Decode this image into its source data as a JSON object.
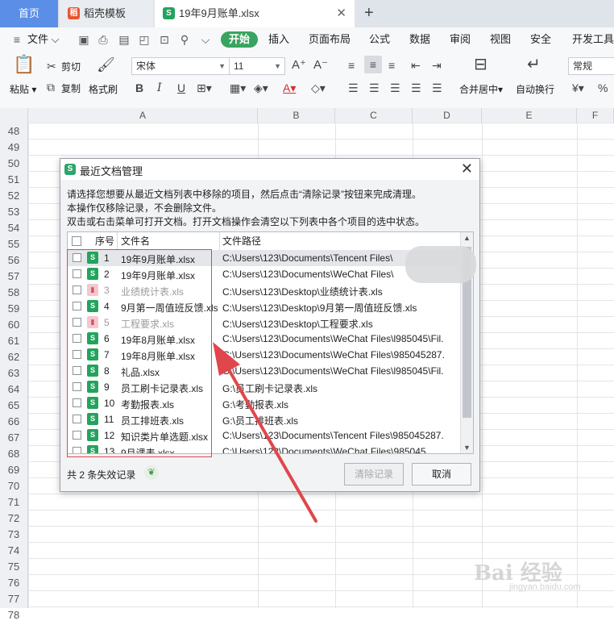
{
  "tabs": [
    {
      "label": "首页"
    },
    {
      "label": "稻壳模板"
    },
    {
      "label": "19年9月账单.xlsx"
    }
  ],
  "menu": {
    "file": "文件",
    "items": [
      "开始",
      "插入",
      "页面布局",
      "公式",
      "数据",
      "审阅",
      "视图",
      "安全",
      "开发工具"
    ]
  },
  "ribbon": {
    "paste": "粘贴",
    "cut": "剪切",
    "copy": "复制",
    "format_painter": "格式刷",
    "font_name": "宋体",
    "font_size": "11",
    "merge_center": "合并居中",
    "wrap_text": "自动换行",
    "number_format": "常规"
  },
  "sheet": {
    "columns": [
      "A",
      "B",
      "C",
      "D",
      "E",
      "F"
    ],
    "rows": [
      "48",
      "49",
      "50",
      "51",
      "52",
      "53",
      "54",
      "55",
      "56",
      "57",
      "58",
      "59",
      "60",
      "61",
      "62",
      "63",
      "64",
      "65",
      "66",
      "67",
      "68",
      "69",
      "70",
      "71",
      "72",
      "73",
      "74",
      "75",
      "76",
      "77",
      "78"
    ]
  },
  "dialog": {
    "title": "最近文档管理",
    "desc1": "请选择您想要从最近文档列表中移除的项目，然后点击“清除记录”按钮来完成清理。",
    "desc2": "本操作仅移除记录，不会删除文件。",
    "desc3": "双击或右击菜单可打开文档。打开文档操作会清空以下列表中各个项目的选中状态。",
    "header": {
      "num": "序号",
      "name": "文件名",
      "path": "文件路径"
    },
    "rows": [
      {
        "num": "1",
        "name": "19年9月账单.xlsx",
        "path": "C:\\Users\\123\\Documents\\Tencent Files\\",
        "valid": true
      },
      {
        "num": "2",
        "name": "19年9月账单.xlsx",
        "path": "C:\\Users\\123\\Documents\\WeChat Files\\",
        "valid": true
      },
      {
        "num": "3",
        "name": "业绩统计表.xls",
        "path": "C:\\Users\\123\\Desktop\\业绩统计表.xls",
        "valid": false
      },
      {
        "num": "4",
        "name": "9月第一周值班反馈.xls",
        "path": "C:\\Users\\123\\Desktop\\9月第一周值班反馈.xls",
        "valid": true
      },
      {
        "num": "5",
        "name": "工程要求.xls",
        "path": "C:\\Users\\123\\Desktop\\工程要求.xls",
        "valid": false
      },
      {
        "num": "6",
        "name": "19年8月账单.xlsx",
        "path": "C:\\Users\\123\\Documents\\WeChat Files\\l985045\\Fil.",
        "valid": true
      },
      {
        "num": "7",
        "name": "19年8月账单.xlsx",
        "path": "C:\\Users\\123\\Documents\\WeChat Files\\985045287.",
        "valid": true
      },
      {
        "num": "8",
        "name": "礼品.xlsx",
        "path": "C:\\Users\\123\\Documents\\WeChat Files\\l985045\\Fil.",
        "valid": true
      },
      {
        "num": "9",
        "name": "员工刷卡记录表.xls",
        "path": "G:\\员工刷卡记录表.xls",
        "valid": true
      },
      {
        "num": "10",
        "name": "考勤报表.xls",
        "path": "G:\\考勤报表.xls",
        "valid": true
      },
      {
        "num": "11",
        "name": "员工排班表.xls",
        "path": "G:\\员工排班表.xls",
        "valid": true
      },
      {
        "num": "12",
        "name": "知识类片单选题.xlsx",
        "path": "C:\\Users\\123\\Documents\\Tencent Files\\985045287.",
        "valid": true
      },
      {
        "num": "13",
        "name": "9月课表.xlsx",
        "path": "C:\\Users\\123\\Documents\\WeChat Files\\985045",
        "valid": true
      }
    ],
    "invalid_count": "共 2 条失效记录",
    "clear_button": "清除记录",
    "cancel_button": "取消"
  },
  "watermark": {
    "logo": "Bai 经验",
    "url": "jingyan.baidu.com"
  },
  "colors": {
    "accent": "#39a460",
    "annotation": "#e0474c",
    "home_tab": "#5b8ee6"
  }
}
